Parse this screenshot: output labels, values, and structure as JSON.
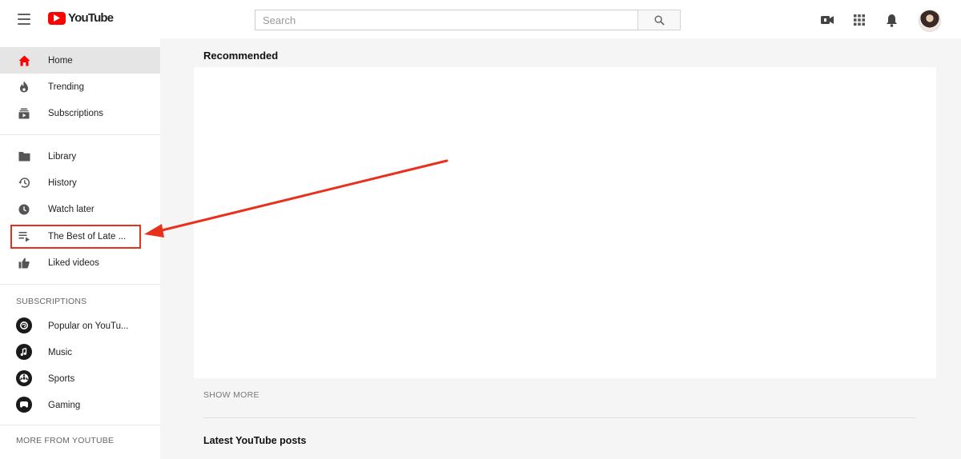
{
  "header": {
    "logo_text": "YouTube",
    "search": {
      "placeholder": "Search",
      "value": ""
    }
  },
  "sidebar": {
    "primary": [
      {
        "label": "Home",
        "icon": "home-icon",
        "active": true
      },
      {
        "label": "Trending",
        "icon": "flame-icon"
      },
      {
        "label": "Subscriptions",
        "icon": "subscriptions-icon"
      }
    ],
    "library": [
      {
        "label": "Library",
        "icon": "folder-icon"
      },
      {
        "label": "History",
        "icon": "history-icon"
      },
      {
        "label": "Watch later",
        "icon": "clock-icon"
      },
      {
        "label": "The Best of Late ...",
        "icon": "playlist-icon"
      },
      {
        "label": "Liked videos",
        "icon": "thumbs-up-icon"
      }
    ],
    "subscriptions_heading": "SUBSCRIPTIONS",
    "subscriptions": [
      {
        "label": "Popular on YouTu..."
      },
      {
        "label": "Music"
      },
      {
        "label": "Sports"
      },
      {
        "label": "Gaming"
      }
    ],
    "more_heading": "MORE FROM YOUTUBE"
  },
  "main": {
    "recommended_title": "Recommended",
    "show_more": "SHOW MORE",
    "posts_title": "Latest YouTube posts"
  },
  "colors": {
    "brand_red": "#ff0000",
    "annotation_red": "#e8311d",
    "active_bg": "#e5e5e5"
  }
}
